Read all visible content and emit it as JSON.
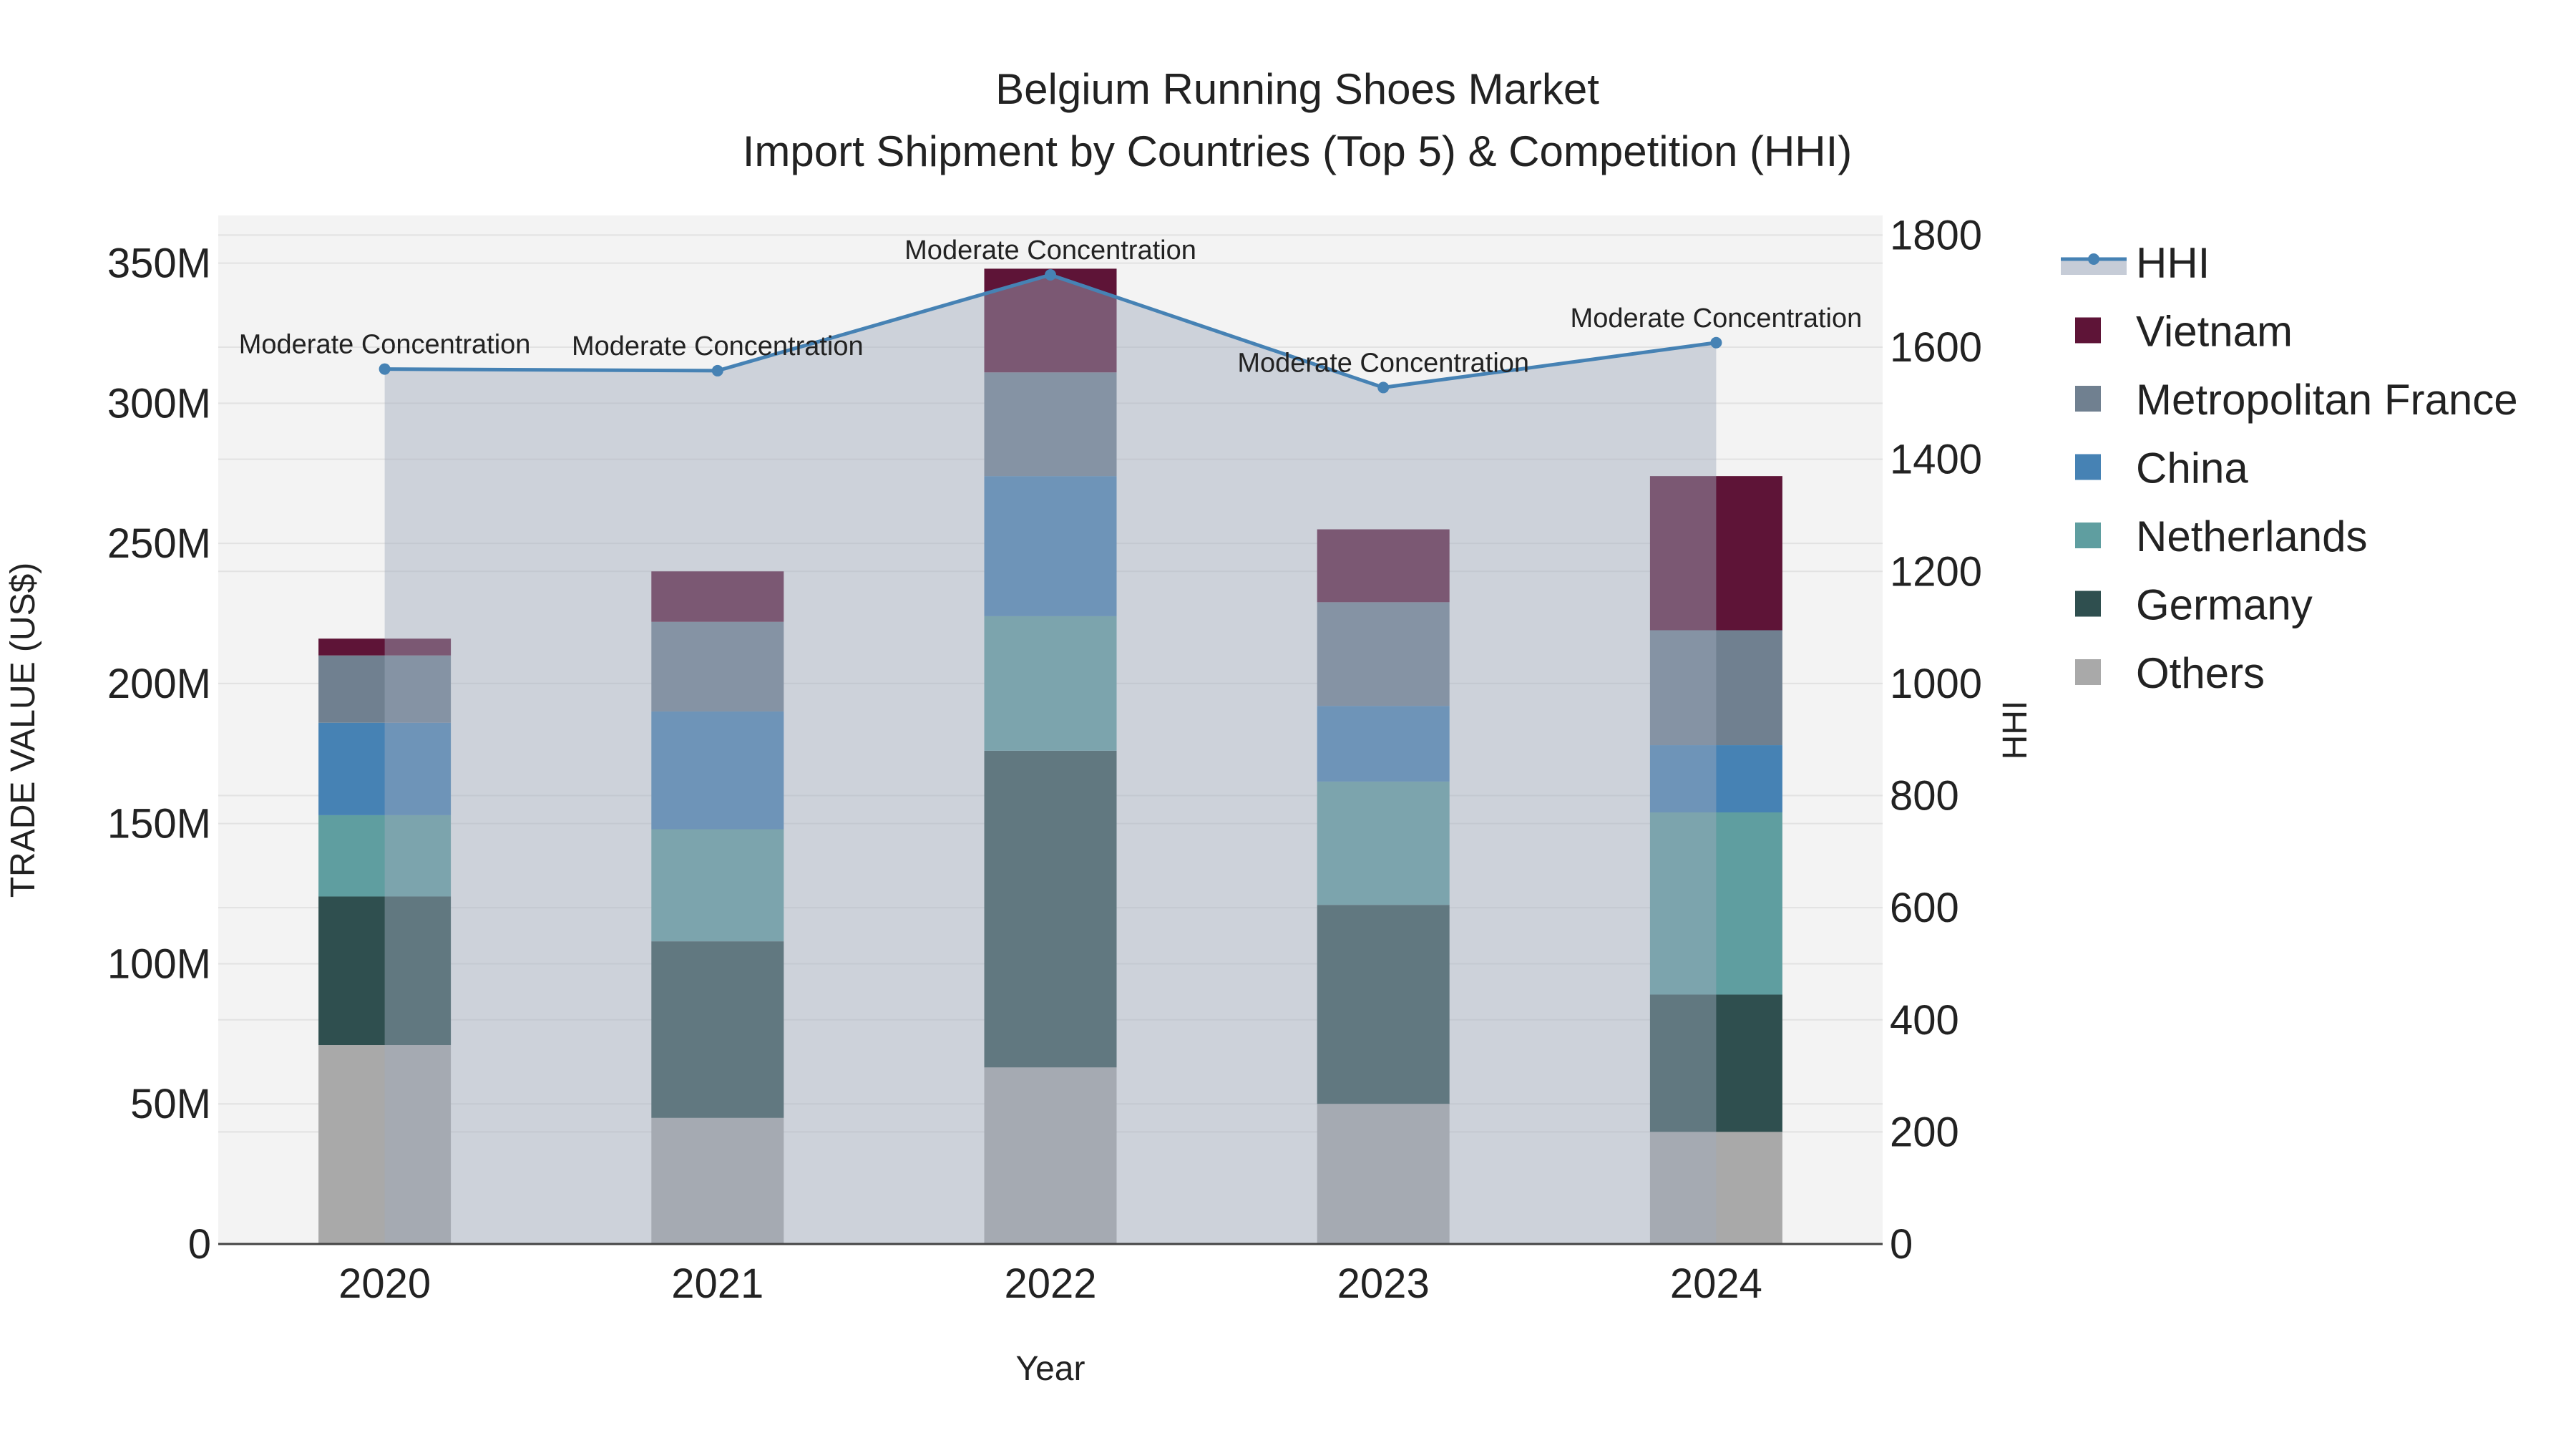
{
  "chart_data": {
    "type": "bar",
    "title": [
      "Belgium Running Shoes Market",
      "Import Shipment by Countries (Top 5) & Competition (HHI)"
    ],
    "xlabel": "Year",
    "ylabel": "TRADE VALUE (US$)",
    "y2label": "HHI",
    "categories": [
      "2020",
      "2021",
      "2022",
      "2023",
      "2024"
    ],
    "ylim": [
      0,
      367
    ],
    "y_unit": "M",
    "yticks": [
      0,
      50,
      100,
      150,
      200,
      250,
      300,
      350
    ],
    "ytick_labels": [
      "0",
      "50M",
      "100M",
      "150M",
      "200M",
      "250M",
      "300M",
      "350M"
    ],
    "y2lim": [
      0,
      1835
    ],
    "y2ticks": [
      0,
      200,
      400,
      600,
      800,
      1000,
      1200,
      1400,
      1600,
      1800
    ],
    "y2tick_labels": [
      "0",
      "200",
      "400",
      "600",
      "800",
      "1000",
      "1200",
      "1400",
      "1600",
      "1800"
    ],
    "series": [
      {
        "name": "Others",
        "color": "#a9a9a9",
        "values": [
          71,
          45,
          63,
          50,
          40
        ]
      },
      {
        "name": "Germany",
        "color": "#2f4f4f",
        "values": [
          53,
          63,
          113,
          71,
          49
        ]
      },
      {
        "name": "Netherlands",
        "color": "#5f9ea0",
        "values": [
          29,
          40,
          48,
          44,
          65
        ]
      },
      {
        "name": "China",
        "color": "#4682b4",
        "values": [
          33,
          42,
          50,
          27,
          24
        ]
      },
      {
        "name": "Metropolitan France",
        "color": "#708090",
        "values": [
          24,
          32,
          37,
          37,
          41
        ]
      },
      {
        "name": "Vietnam",
        "color": "#5e1437",
        "values": [
          6,
          18,
          37,
          26,
          55
        ]
      }
    ],
    "hhi": {
      "name": "HHI",
      "color": "#4682b4",
      "values": [
        1561,
        1558,
        1729,
        1528,
        1608
      ]
    },
    "annotations": [
      "Moderate Concentration",
      "Moderate Concentration",
      "Moderate Concentration",
      "Moderate Concentration",
      "Moderate Concentration"
    ],
    "legend_order": [
      "HHI",
      "Vietnam",
      "Metropolitan France",
      "China",
      "Netherlands",
      "Germany",
      "Others"
    ],
    "legend_position": "right"
  }
}
